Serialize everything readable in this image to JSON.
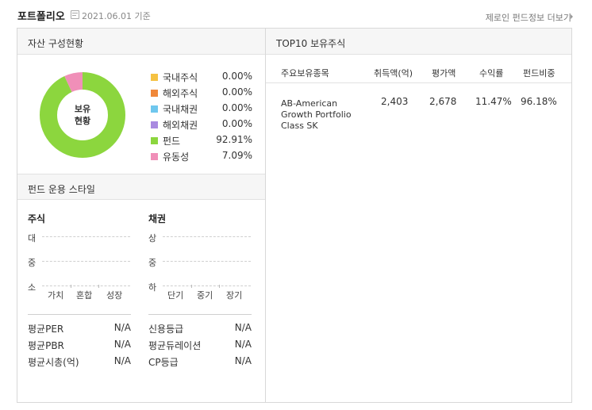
{
  "header": {
    "title": "포트폴리오",
    "date": "2021.06.01 기준",
    "more_link": "제로인 펀드정보 더보기"
  },
  "asset_composition": {
    "section_title": "자산 구성현황",
    "donut_label_line1": "보유",
    "donut_label_line2": "현황",
    "items": [
      {
        "name": "국내주식",
        "value": "0.00%",
        "pct": 0.0,
        "color": "#f5c242"
      },
      {
        "name": "해외주식",
        "value": "0.00%",
        "pct": 0.0,
        "color": "#f0883a"
      },
      {
        "name": "국내채권",
        "value": "0.00%",
        "pct": 0.0,
        "color": "#6fc7ee"
      },
      {
        "name": "해외채권",
        "value": "0.00%",
        "pct": 0.0,
        "color": "#a98ae0"
      },
      {
        "name": "펀드",
        "value": "92.91%",
        "pct": 92.91,
        "color": "#8cd63e"
      },
      {
        "name": "유동성",
        "value": "7.09%",
        "pct": 7.09,
        "color": "#f08fb8"
      }
    ]
  },
  "fund_style": {
    "section_title": "펀드 운용 스타일",
    "equity": {
      "title": "주식",
      "y_labels": [
        "대",
        "중",
        "소"
      ],
      "x_labels": [
        "가치",
        "혼합",
        "성장"
      ],
      "metrics": [
        {
          "name": "평균PER",
          "value": "N/A"
        },
        {
          "name": "평균PBR",
          "value": "N/A"
        },
        {
          "name": "평균시총(억)",
          "value": "N/A"
        }
      ]
    },
    "bond": {
      "title": "채권",
      "y_labels": [
        "상",
        "중",
        "하"
      ],
      "x_labels": [
        "단기",
        "중기",
        "장기"
      ],
      "metrics": [
        {
          "name": "신용등급",
          "value": "N/A"
        },
        {
          "name": "평균듀레이션",
          "value": "N/A"
        },
        {
          "name": "CP등급",
          "value": "N/A"
        }
      ]
    }
  },
  "top10": {
    "section_title": "TOP10 보유주식",
    "columns": [
      "주요보유종목",
      "취득액(억)",
      "평가액",
      "수익률",
      "펀드비중"
    ],
    "rows": [
      {
        "name": "AB-American Growth Portfolio Class SK",
        "acq": "2,403",
        "eval": "2,678",
        "ret": "11.47%",
        "weight": "96.18%"
      }
    ]
  }
}
